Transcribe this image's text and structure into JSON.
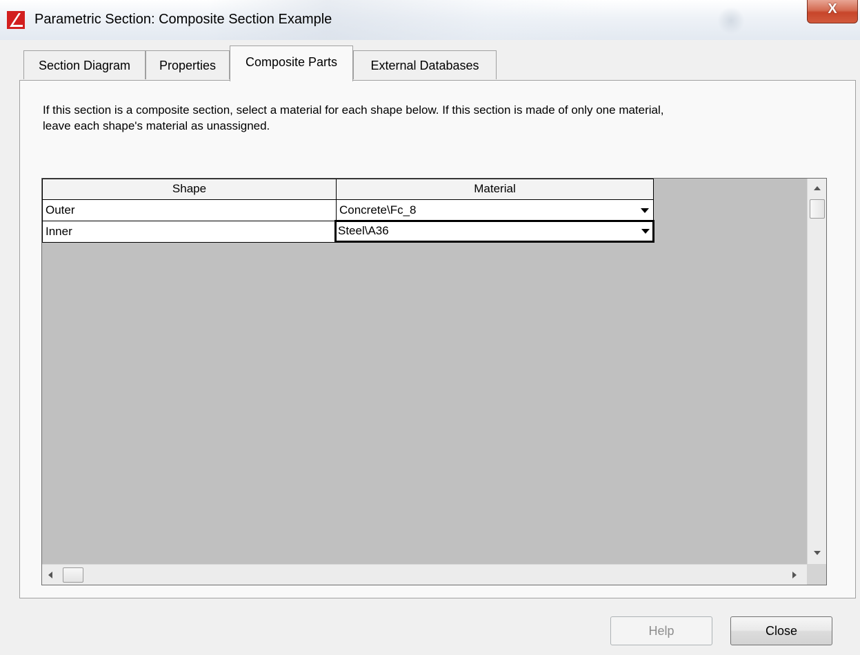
{
  "window": {
    "title": "Parametric Section: Composite Section Example",
    "close_glyph": "X",
    "icon": "app-logo-icon"
  },
  "tabs": [
    {
      "label": "Section Diagram",
      "active": false
    },
    {
      "label": "Properties",
      "active": false
    },
    {
      "label": "Composite Parts",
      "active": true
    },
    {
      "label": "External Databases",
      "active": false
    }
  ],
  "composite_parts": {
    "instructions_line1": "If this section is a composite section, select a material for each shape below.  If this section is made of only one material,",
    "instructions_line2": "leave each shape's material as unassigned.",
    "grid": {
      "columns": [
        "Shape",
        "Material"
      ],
      "rows": [
        {
          "shape": "Outer",
          "material": "Concrete\\Fc_8",
          "selected": false
        },
        {
          "shape": "Inner",
          "material": "Steel\\A36",
          "selected": true
        }
      ]
    }
  },
  "buttons": {
    "help": {
      "label": "Help",
      "enabled": false
    },
    "close": {
      "label": "Close",
      "enabled": true
    }
  },
  "colors": {
    "window_bg": "#f0f0f0",
    "grid_empty_area": "#c0c0c0",
    "close_button_red": "#c7452a",
    "app_icon_red": "#d21f1f"
  }
}
